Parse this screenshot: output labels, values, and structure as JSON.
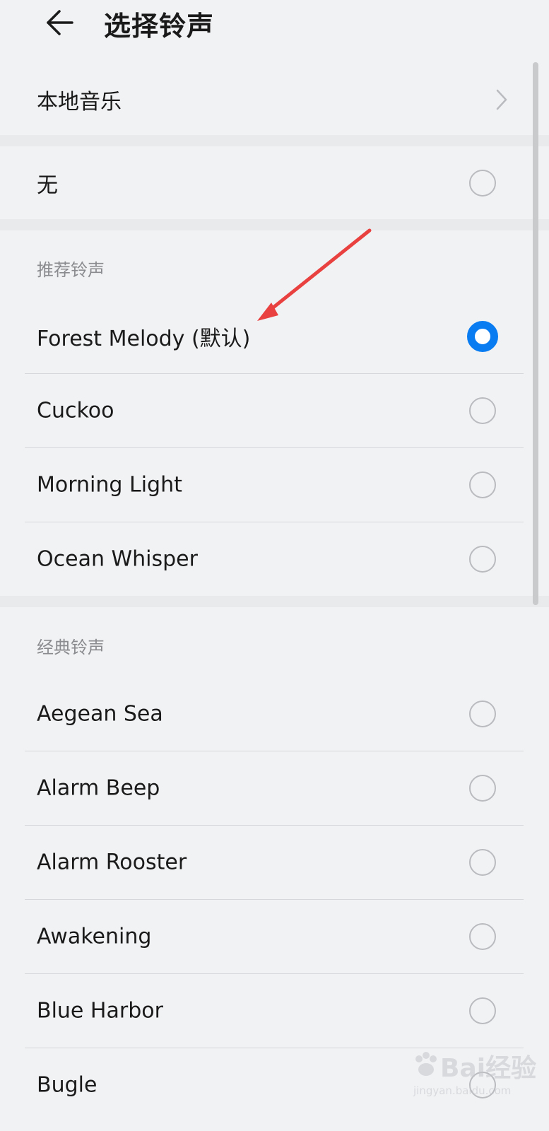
{
  "header": {
    "title": "选择铃声",
    "back_icon": "arrow-left-icon"
  },
  "local_music": {
    "label": "本地音乐",
    "icon": "chevron-right-icon"
  },
  "none_option": {
    "label": "无",
    "selected": false
  },
  "recommended": {
    "title": "推荐铃声",
    "items": [
      {
        "label": "Forest Melody (默认)",
        "selected": true
      },
      {
        "label": "Cuckoo",
        "selected": false
      },
      {
        "label": "Morning Light",
        "selected": false
      },
      {
        "label": "Ocean Whisper",
        "selected": false
      }
    ]
  },
  "classic": {
    "title": "经典铃声",
    "items": [
      {
        "label": "Aegean Sea",
        "selected": false
      },
      {
        "label": "Alarm Beep",
        "selected": false
      },
      {
        "label": "Alarm Rooster",
        "selected": false
      },
      {
        "label": "Awakening",
        "selected": false
      },
      {
        "label": "Blue Harbor",
        "selected": false
      },
      {
        "label": "Bugle",
        "selected": false
      }
    ]
  },
  "watermark": {
    "text": "Bai经验",
    "sub": "jingyan.baidu.com"
  },
  "colors": {
    "accent": "#0a7cf2",
    "annotation_arrow": "#e8413f",
    "background": "#f1f2f4"
  }
}
